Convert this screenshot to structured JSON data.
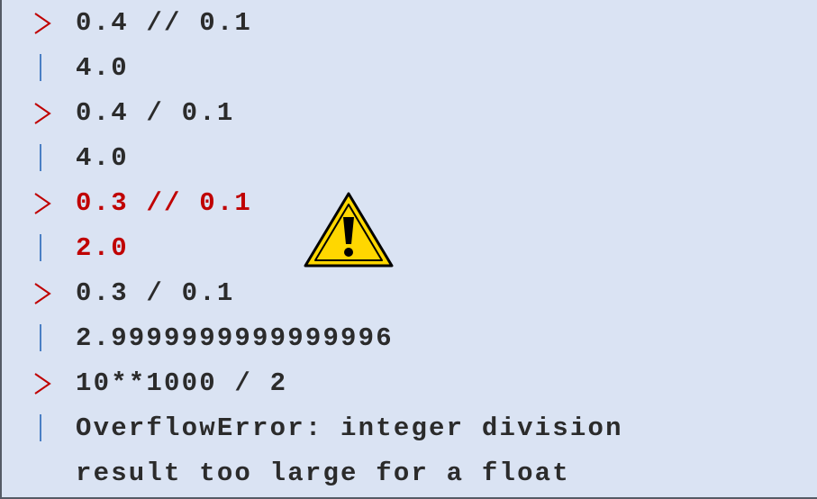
{
  "lines": [
    {
      "kind": "input",
      "text": "0.4 // 0.1",
      "highlight": false
    },
    {
      "kind": "output",
      "text": "4.0",
      "highlight": false
    },
    {
      "kind": "input",
      "text": "0.4 / 0.1",
      "highlight": false
    },
    {
      "kind": "output",
      "text": "4.0",
      "highlight": false
    },
    {
      "kind": "input",
      "text": "0.3 // 0.1",
      "highlight": true
    },
    {
      "kind": "output",
      "text": "2.0",
      "highlight": true
    },
    {
      "kind": "input",
      "text": "0.3 / 0.1",
      "highlight": false
    },
    {
      "kind": "output",
      "text": "2.9999999999999996",
      "highlight": false
    },
    {
      "kind": "input",
      "text": "10**1000 / 2",
      "highlight": false
    },
    {
      "kind": "output",
      "text": "OverflowError: integer division",
      "highlight": false
    },
    {
      "kind": "continuation",
      "text": "result too large for a float",
      "highlight": false
    }
  ],
  "icons": {
    "prompt": "chevron-right-icon",
    "output": "output-bar-icon",
    "warning": "warning-triangle-icon"
  },
  "colors": {
    "background": "#dae3f3",
    "text": "#2b2b2b",
    "highlight": "#c00000",
    "prompt_marker": "#c00000",
    "output_marker": "#4a7fc4",
    "warning_fill": "#ffd700"
  }
}
